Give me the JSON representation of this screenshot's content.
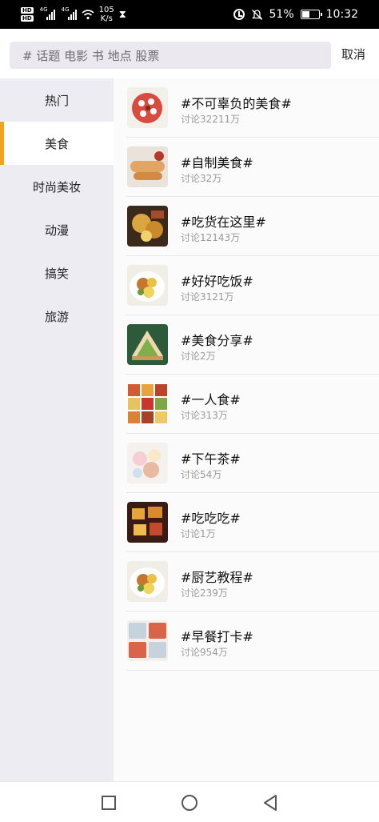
{
  "status_bar": {
    "hd1": "HD",
    "hd2": "HD",
    "net1": "4G",
    "net2": "4G",
    "speed_value": "105",
    "speed_unit": "K/s",
    "battery_percent": "51%",
    "battery_level": 0.51,
    "time": "10:32"
  },
  "search": {
    "placeholder": "# 话题 电影 书 地点 股票",
    "cancel_label": "取消"
  },
  "sidebar": {
    "items": [
      {
        "label": "热门"
      },
      {
        "label": "美食"
      },
      {
        "label": "时尚美妆"
      },
      {
        "label": "动漫"
      },
      {
        "label": "搞笑"
      },
      {
        "label": "旅游"
      }
    ],
    "active_index": 1,
    "accent_color": "#f6a21a"
  },
  "topics": [
    {
      "title": "#不可辜负的美食#",
      "sub": "讨论32211万",
      "image": "food-cake-image"
    },
    {
      "title": "#自制美食#",
      "sub": "讨论32万",
      "image": "food-rolls-image"
    },
    {
      "title": "#吃货在这里#",
      "sub": "讨论12143万",
      "image": "food-snacks-image"
    },
    {
      "title": "#好好吃饭#",
      "sub": "讨论3121万",
      "image": "food-plate-image"
    },
    {
      "title": "#美食分享#",
      "sub": "讨论2万",
      "image": "food-sandwich-image"
    },
    {
      "title": "#一人食#",
      "sub": "讨论313万",
      "image": "food-grid-image"
    },
    {
      "title": "#下午茶#",
      "sub": "讨论54万",
      "image": "food-tea-image"
    },
    {
      "title": "#吃吃吃#",
      "sub": "讨论1万",
      "image": "food-tofu-image"
    },
    {
      "title": "#厨艺教程#",
      "sub": "讨论239万",
      "image": "food-plate-image"
    },
    {
      "title": "#早餐打卡#",
      "sub": "讨论954万",
      "image": "food-breakfast-image"
    }
  ],
  "nav": {
    "recents_icon": "square-icon",
    "home_icon": "circle-icon",
    "back_icon": "triangle-back-icon"
  }
}
